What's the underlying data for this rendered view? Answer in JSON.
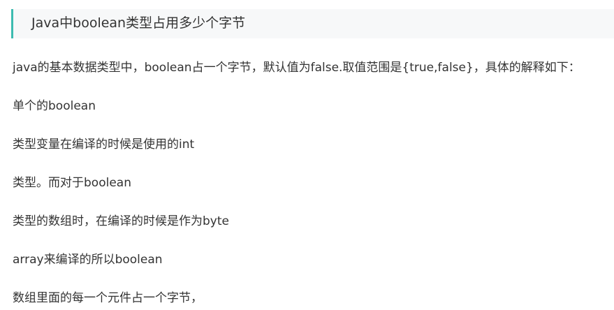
{
  "article": {
    "heading": "Java中boolean类型占用多少个字节",
    "paragraphs": [
      "java的基本数据类型中，boolean占一个字节，默认值为false.取值范围是{true,false}，具体的解释如下：",
      "单个的boolean",
      "类型变量在编译的时候是使用的int",
      "类型。而对于boolean",
      "类型的数组时，在编译的时候是作为byte",
      "array来编译的所以boolean",
      "数组里面的每一个元件占一个字节，"
    ],
    "colors": {
      "heading_accent": "#3dbbb0",
      "heading_background": "#f7f8f9",
      "text": "#333333"
    }
  }
}
